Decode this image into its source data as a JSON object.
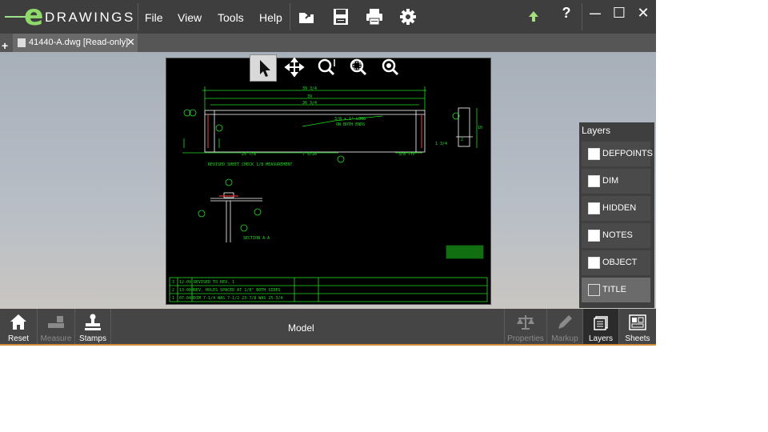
{
  "app": {
    "logo_text": "DRAWINGS",
    "logo_e": "e"
  },
  "menu": {
    "file": "File",
    "view": "View",
    "tools": "Tools",
    "help": "Help"
  },
  "toolbar_icons": [
    "open-icon",
    "save-icon",
    "print-icon",
    "settings-icon",
    "upload-icon",
    "help-icon"
  ],
  "window": {
    "help": "?",
    "minimize": "—",
    "maximize": "☐",
    "close": "✕"
  },
  "tab": {
    "title": "41440-A.dwg [Read-only]",
    "close": "✕",
    "add": "+"
  },
  "view_tools": [
    "select-icon",
    "pan-icon",
    "zoom-icon",
    "zoom-area-icon",
    "zoom-fit-icon"
  ],
  "drawing": {
    "dims": [
      "39 3/4",
      "39",
      "36 3/4",
      "25 7/8",
      "7 5/16",
      "3/8 TYP"
    ],
    "note1": "3/8 x 1\" LONG",
    "note2": "ON BOTH ENDS",
    "revised": "REVISED SHEET CHECK 1/8 MEASUREMENT",
    "section": "SECTION A-A",
    "side_dims": [
      "10",
      "2",
      "1 3/4"
    ],
    "rev_rows": [
      {
        "rev": "3",
        "ref": "12-09",
        "desc": "REVISED TO REV. 1"
      },
      {
        "rev": "2",
        "ref": "13-080",
        "desc": "REV. HOLES SPACED AT 1/8\" BOTH SIDES"
      },
      {
        "rev": "1",
        "ref": "07-048",
        "desc": "DIM 7-1/4 WAS 7-1/2  23-7/8 WAS 25-3/4"
      }
    ]
  },
  "layers": {
    "header": "Layers",
    "items": [
      {
        "name": "DEFPOINTS",
        "checked": true
      },
      {
        "name": "DIM",
        "checked": true
      },
      {
        "name": "HIDDEN",
        "checked": true
      },
      {
        "name": "NOTES",
        "checked": true
      },
      {
        "name": "OBJECT",
        "checked": true
      },
      {
        "name": "TITLE",
        "checked": false
      }
    ]
  },
  "bottom": {
    "reset": "Reset",
    "measure": "Measure",
    "stamps": "Stamps",
    "model": "Model",
    "properties": "Properties",
    "markup": "Markup",
    "layers": "Layers",
    "sheets": "Sheets"
  }
}
